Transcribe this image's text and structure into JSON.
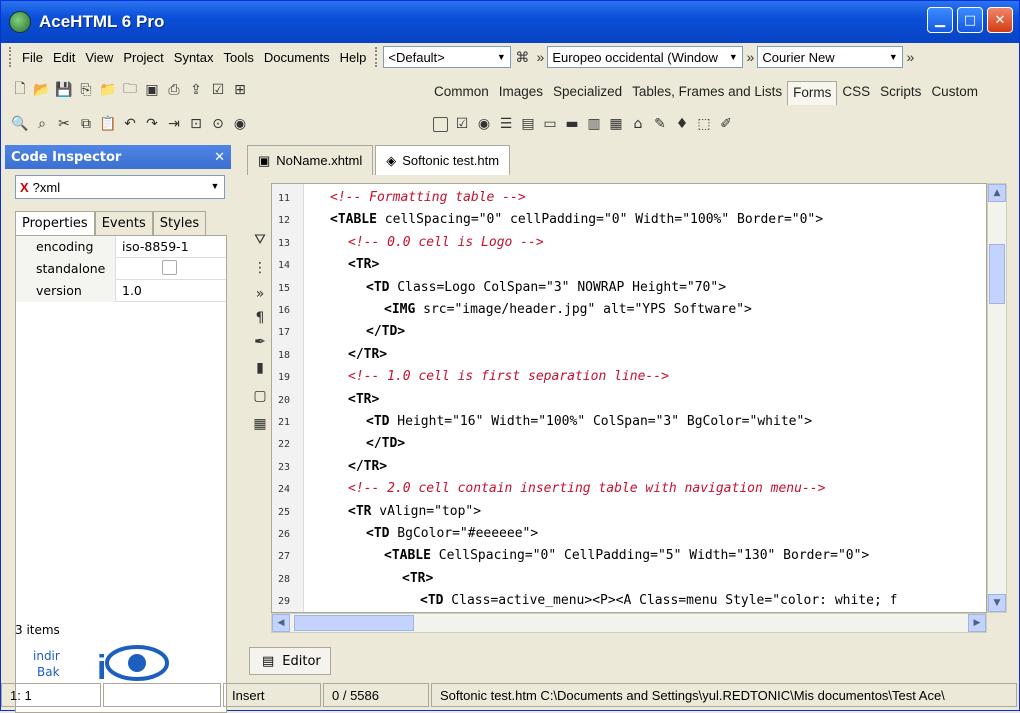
{
  "window": {
    "title": "AceHTML 6 Pro"
  },
  "menu": [
    "File",
    "Edit",
    "View",
    "Project",
    "Syntax",
    "Tools",
    "Documents",
    "Help"
  ],
  "combos": {
    "profile": "<Default>",
    "encoding": "Europeo occidental (Window",
    "font": "Courier New"
  },
  "toolbar_tabs": [
    "Common",
    "Images",
    "Specialized",
    "Tables, Frames and Lists",
    "Forms",
    "CSS",
    "Scripts",
    "Custom"
  ],
  "active_toolbar_tab": "Forms",
  "code_inspector": {
    "title": "Code Inspector",
    "selector": "?xml",
    "tabs": [
      "Properties",
      "Events",
      "Styles"
    ],
    "properties": [
      {
        "key": "encoding",
        "value": "iso-8859-1"
      },
      {
        "key": "standalone",
        "value": ""
      },
      {
        "key": "version",
        "value": "1.0"
      }
    ],
    "count": "3 items"
  },
  "doc_tabs": [
    "NoName.xhtml",
    "Softonic test.htm"
  ],
  "active_doc": "Softonic test.htm",
  "editor_tab": "Editor",
  "code_lines": [
    {
      "n": "11",
      "indent": 1,
      "parts": [
        {
          "c": "cm",
          "t": "<!-- Formatting table -->"
        }
      ]
    },
    {
      "n": "12",
      "indent": 1,
      "parts": [
        {
          "c": "tg",
          "t": "<TABLE"
        },
        {
          "c": "",
          "t": " cellSpacing=\"0\" cellPadding=\"0\" Width=\"100%\" Border=\"0\">"
        }
      ]
    },
    {
      "n": "13",
      "indent": 2,
      "parts": [
        {
          "c": "cm",
          "t": "<!-- 0.0 cell is Logo -->"
        }
      ]
    },
    {
      "n": "14",
      "indent": 2,
      "parts": [
        {
          "c": "tg",
          "t": "<TR>"
        }
      ]
    },
    {
      "n": "15",
      "indent": 3,
      "parts": [
        {
          "c": "tg",
          "t": "<TD"
        },
        {
          "c": "",
          "t": " Class=Logo ColSpan=\"3\" NOWRAP Height=\"70\">"
        }
      ]
    },
    {
      "n": "16",
      "indent": 4,
      "parts": [
        {
          "c": "tg",
          "t": "<IMG"
        },
        {
          "c": "",
          "t": " src=\"image/header.jpg\" alt=\"YPS Software\">"
        }
      ]
    },
    {
      "n": "17",
      "indent": 3,
      "parts": [
        {
          "c": "tg",
          "t": "</TD>"
        }
      ]
    },
    {
      "n": "18",
      "indent": 2,
      "parts": [
        {
          "c": "tg",
          "t": "</TR>"
        }
      ]
    },
    {
      "n": "19",
      "indent": 2,
      "parts": [
        {
          "c": "cm",
          "t": "<!-- 1.0 cell is first separation line-->"
        }
      ]
    },
    {
      "n": "20",
      "indent": 2,
      "parts": [
        {
          "c": "tg",
          "t": "<TR>"
        }
      ]
    },
    {
      "n": "21",
      "indent": 3,
      "parts": [
        {
          "c": "tg",
          "t": "<TD"
        },
        {
          "c": "",
          "t": " Height=\"16\" Width=\"100%\" ColSpan=\"3\" BgColor=\"white\">"
        }
      ]
    },
    {
      "n": "22",
      "indent": 3,
      "parts": [
        {
          "c": "tg",
          "t": "</TD>"
        }
      ]
    },
    {
      "n": "23",
      "indent": 2,
      "parts": [
        {
          "c": "tg",
          "t": "</TR>"
        }
      ]
    },
    {
      "n": "24",
      "indent": 2,
      "parts": [
        {
          "c": "cm",
          "t": "<!-- 2.0 cell contain inserting table with navigation menu-->"
        }
      ]
    },
    {
      "n": "25",
      "indent": 2,
      "parts": [
        {
          "c": "tg",
          "t": "<TR"
        },
        {
          "c": "",
          "t": " vAlign=\"top\">"
        }
      ]
    },
    {
      "n": "26",
      "indent": 3,
      "parts": [
        {
          "c": "tg",
          "t": "<TD"
        },
        {
          "c": "",
          "t": " BgColor=\"#eeeeee\">"
        }
      ]
    },
    {
      "n": "27",
      "indent": 4,
      "parts": [
        {
          "c": "tg",
          "t": "<TABLE"
        },
        {
          "c": "",
          "t": " CellSpacing=\"0\" CellPadding=\"5\" Width=\"130\" Border=\"0\">"
        }
      ]
    },
    {
      "n": "28",
      "indent": 5,
      "parts": [
        {
          "c": "tg",
          "t": "<TR>"
        }
      ]
    },
    {
      "n": "29",
      "indent": 6,
      "parts": [
        {
          "c": "tg",
          "t": "<TD"
        },
        {
          "c": "",
          "t": " Class=active_menu><P><A Class=menu Style=\"color: white; f"
        }
      ]
    }
  ],
  "status": {
    "position": "1:    1",
    "mode": "Insert",
    "chars": "0 /    5586",
    "path": "Softonic test.htm  C:\\Documents and Settings\\yul.REDTONIC\\Mis documentos\\Test Ace\\"
  },
  "logo": {
    "line1": "indir",
    "line2": "Bak"
  }
}
